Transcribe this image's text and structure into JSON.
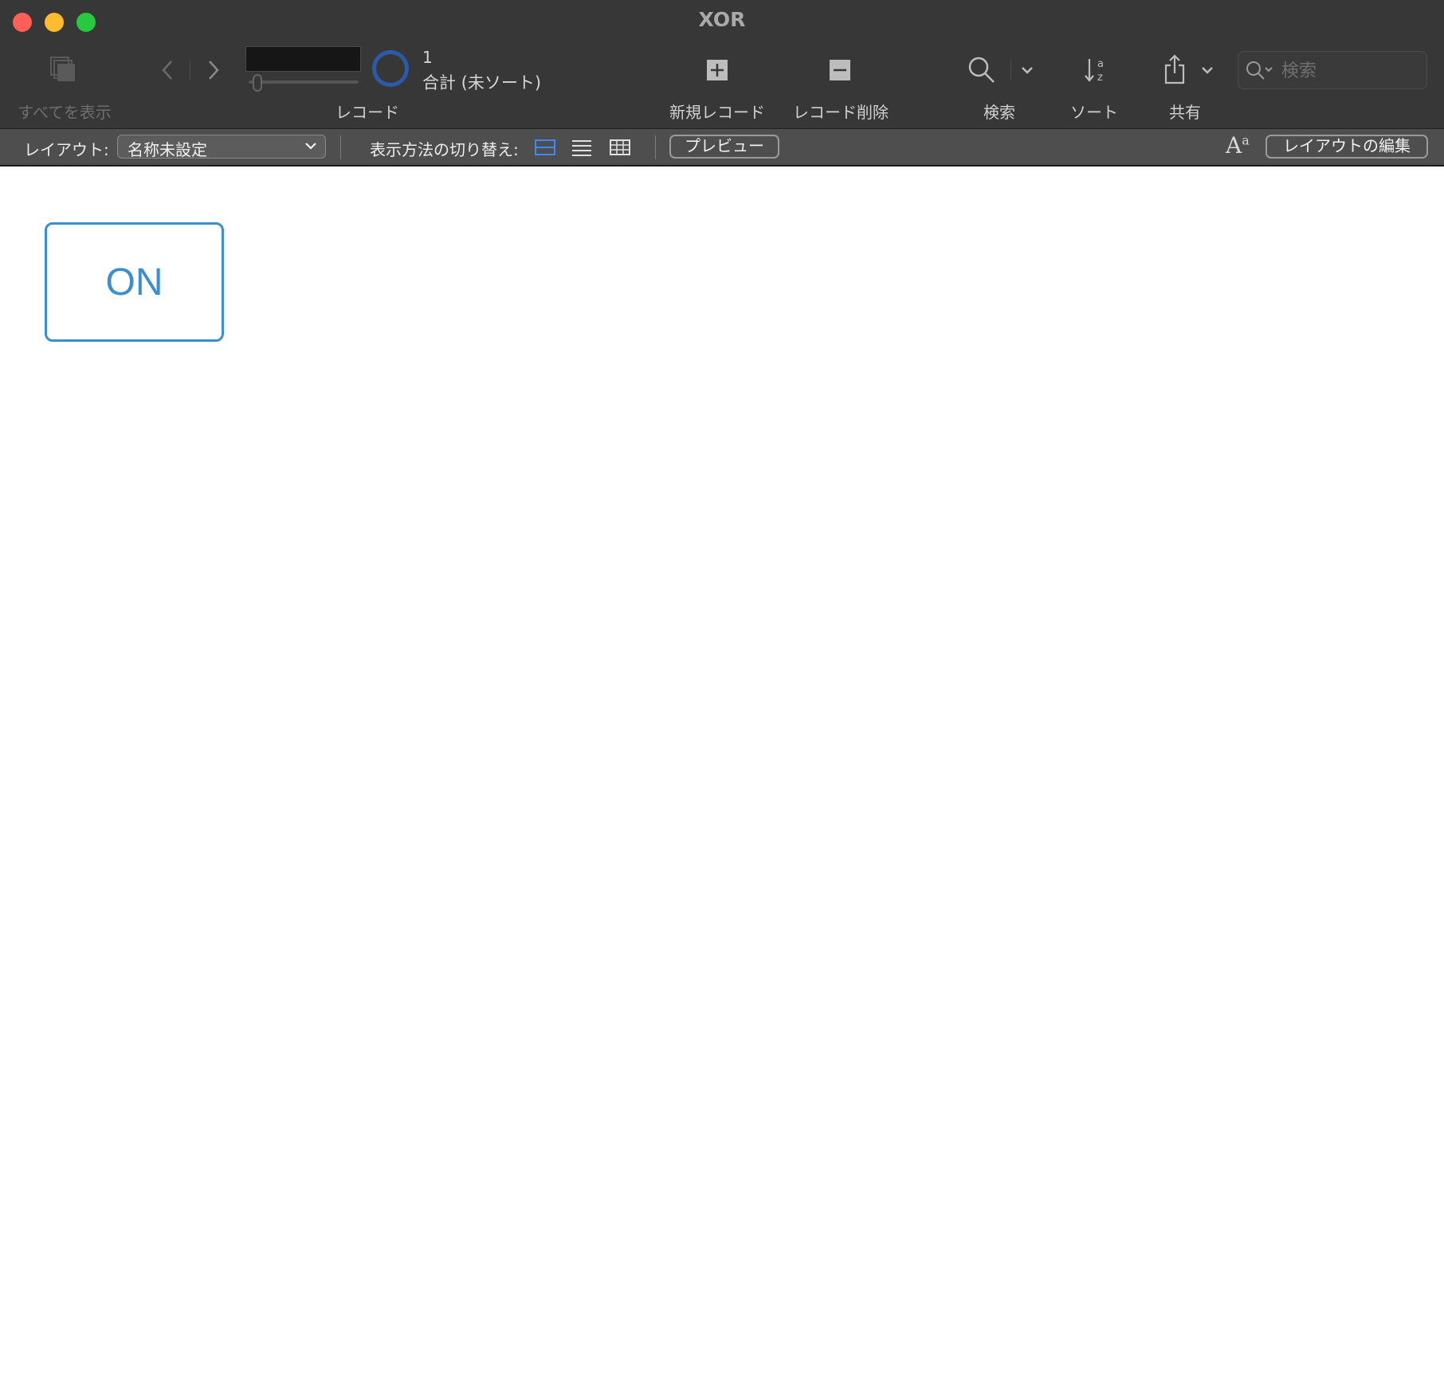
{
  "window": {
    "title": "XOR"
  },
  "toolbar": {
    "show_all_label": "すべてを表示",
    "records_label": "レコード",
    "record_current": "1",
    "record_total": "合計 (未ソート)",
    "new_record_label": "新規レコード",
    "delete_record_label": "レコード削除",
    "find_label": "検索",
    "sort_label": "ソート",
    "share_label": "共有",
    "search_placeholder": "検索"
  },
  "layoutbar": {
    "layout_label": "レイアウト:",
    "layout_value": "名称未設定",
    "view_switch_label": "表示方法の切り替え:",
    "preview_label": "プレビュー",
    "edit_layout_label": "レイアウトの編集",
    "active_view": "form"
  },
  "content": {
    "button_label": "ON"
  },
  "colors": {
    "accent": "#3b8ed0",
    "ring": "#2c5aa8",
    "toolbar_bg": "#373737",
    "layoutbar_bg": "#4e4e4e"
  },
  "icons": [
    "show-all-icon",
    "back-icon",
    "forward-icon",
    "new-record-icon",
    "delete-record-icon",
    "search-icon",
    "chevron-down-icon",
    "sort-icon",
    "share-icon",
    "form-view-icon",
    "list-view-icon",
    "table-view-icon",
    "text-size-icon"
  ]
}
